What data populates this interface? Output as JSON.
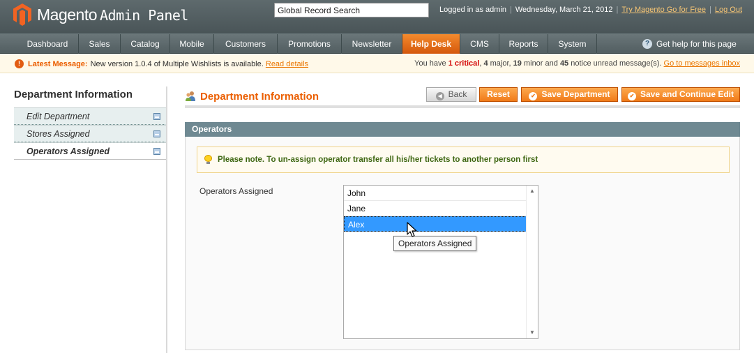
{
  "header": {
    "logo_brand": "Magento",
    "logo_product": "Admin Panel",
    "search_value": "Global Record Search",
    "logged_in": "Logged in as admin",
    "date": "Wednesday, March 21, 2012",
    "try_link": "Try Magento Go for Free",
    "logout_link": "Log Out"
  },
  "nav": {
    "items": [
      {
        "label": "Dashboard"
      },
      {
        "label": "Sales"
      },
      {
        "label": "Catalog"
      },
      {
        "label": "Mobile"
      },
      {
        "label": "Customers"
      },
      {
        "label": "Promotions"
      },
      {
        "label": "Newsletter"
      },
      {
        "label": "Help Desk",
        "active": true
      },
      {
        "label": "CMS"
      },
      {
        "label": "Reports"
      },
      {
        "label": "System"
      }
    ],
    "help": "Get help for this page"
  },
  "messages": {
    "latest_label": "Latest Message:",
    "latest_text": "New version 1.0.4 of Multiple Wishlists is available.",
    "read_details": "Read details",
    "summary_prefix": "You have",
    "critical_count": "1 critical",
    "major": "4",
    "minor": "19",
    "notice": "45",
    "inbox_link": "Go to messages inbox"
  },
  "sidebar": {
    "title": "Department Information",
    "tabs": [
      {
        "label": "Edit Department"
      },
      {
        "label": "Stores Assigned"
      },
      {
        "label": "Operators Assigned",
        "active": true
      }
    ]
  },
  "content": {
    "title": "Department Information",
    "buttons": {
      "back": "Back",
      "reset": "Reset",
      "save": "Save Department",
      "save_continue": "Save and Continue Edit"
    },
    "section_title": "Operators",
    "note": "Please note. To un-assign operator transfer all his/her tickets to another person first",
    "field_label": "Operators Assigned",
    "options": [
      "John",
      "Jane",
      "Alex"
    ],
    "selected_option": "Alex",
    "tooltip": "Operators Assigned"
  },
  "colors": {
    "accent": "#eb5e00",
    "active_nav": "#e86c1a",
    "section_header": "#6f8992",
    "selected": "#3399ff"
  }
}
